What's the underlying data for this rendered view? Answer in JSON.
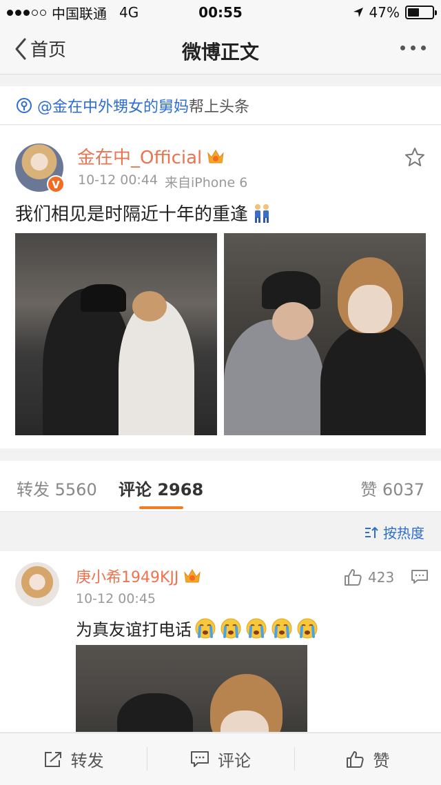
{
  "status_bar": {
    "carrier": "中国联通",
    "network": "4G",
    "time": "00:55",
    "battery_percent": "47%",
    "battery_level": 0.47
  },
  "nav": {
    "back_label": "首页",
    "title": "微博正文"
  },
  "headline": {
    "user_link": "@金在中外甥女的舅妈",
    "suffix": "帮上头条"
  },
  "post": {
    "username": "金在中_Official",
    "time": "10-12 00:44",
    "source": "来自iPhone 6",
    "text": "我们相见是时隔近十年的重逢"
  },
  "stats": {
    "repost_label": "转发",
    "repost_count": "5560",
    "comment_label": "评论",
    "comment_count": "2968",
    "like_label": "赞",
    "like_count": "6037"
  },
  "sort": {
    "label": "按热度"
  },
  "comment": {
    "username": "庚小希1949KJJ",
    "time": "10-12 00:45",
    "like_count": "423",
    "text": "为真友谊打电话"
  },
  "toolbar": {
    "repost": "转发",
    "comment": "评论",
    "like": "赞"
  },
  "colors": {
    "accent_orange": "#eb7350",
    "link_blue": "#2e6dd0",
    "tab_underline": "#f47b20"
  }
}
